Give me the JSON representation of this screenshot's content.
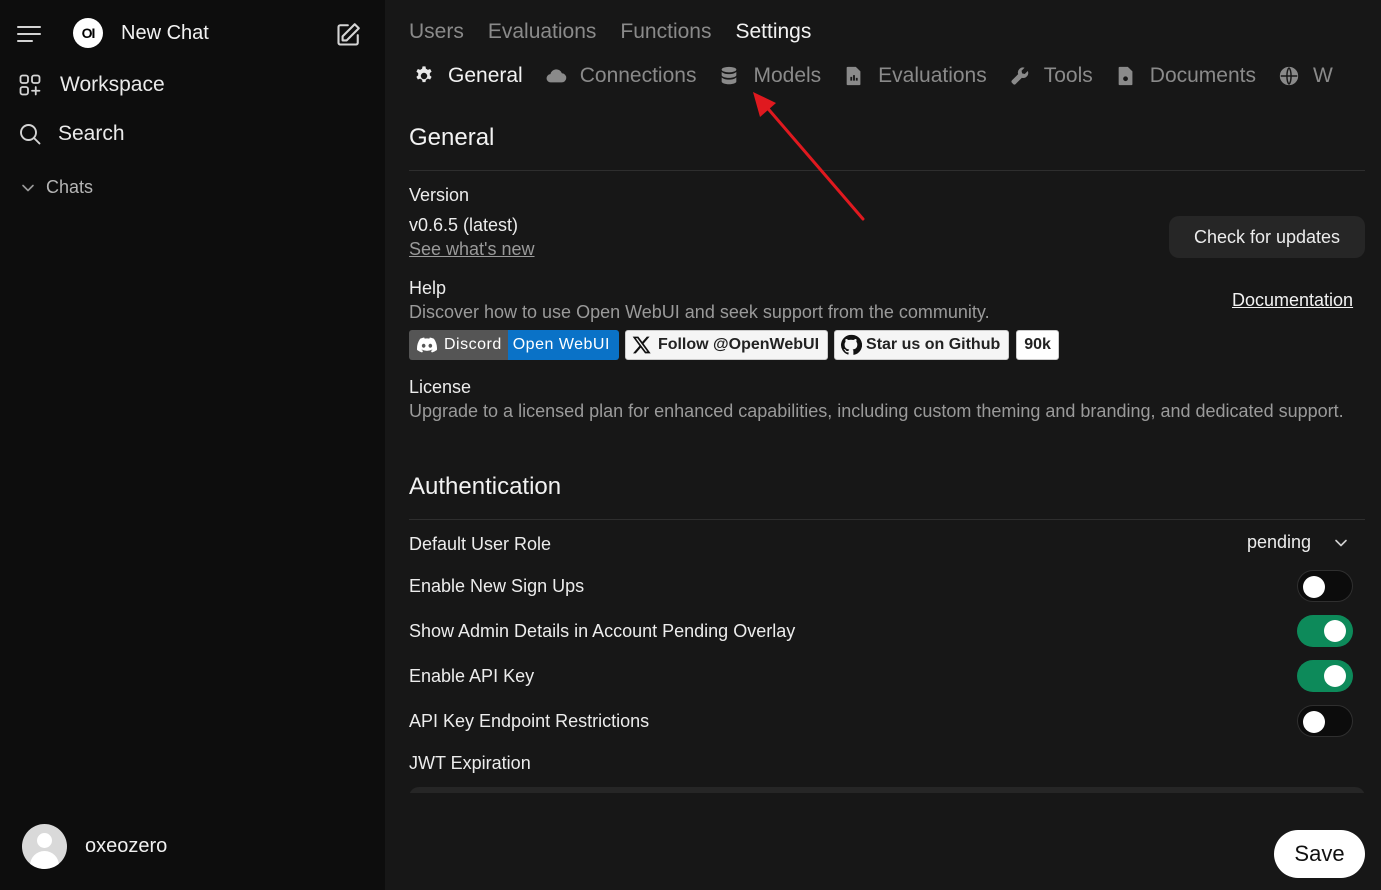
{
  "sidebar": {
    "new_chat_label": "New Chat",
    "logo_text": "OI",
    "items": [
      {
        "label": "Workspace",
        "icon": "workspace-icon"
      },
      {
        "label": "Search",
        "icon": "search-icon"
      }
    ],
    "chats_label": "Chats",
    "username": "oxeozero"
  },
  "top_tabs": [
    {
      "label": "Users",
      "active": false
    },
    {
      "label": "Evaluations",
      "active": false
    },
    {
      "label": "Functions",
      "active": false
    },
    {
      "label": "Settings",
      "active": true
    }
  ],
  "sub_tabs": [
    {
      "label": "General",
      "icon": "gear-icon",
      "active": true
    },
    {
      "label": "Connections",
      "icon": "cloud-icon",
      "active": false
    },
    {
      "label": "Models",
      "icon": "database-icon",
      "active": false
    },
    {
      "label": "Evaluations",
      "icon": "document-chart-icon",
      "active": false
    },
    {
      "label": "Tools",
      "icon": "wrench-icon",
      "active": false
    },
    {
      "label": "Documents",
      "icon": "document-icon",
      "active": false
    },
    {
      "label": "W",
      "icon": "globe-icon",
      "active": false
    }
  ],
  "general": {
    "title": "General",
    "version_label": "Version",
    "version_value": "v0.6.5 (latest)",
    "whats_new_link": "See what's new",
    "check_updates_button": "Check for updates",
    "help_label": "Help",
    "help_text": "Discover how to use Open WebUI and seek support from the community.",
    "documentation_link": "Documentation",
    "badges": {
      "discord_left": "Discord",
      "discord_right": "Open WebUI",
      "x_follow": "Follow @OpenWebUI",
      "github_star": "Star us on Github",
      "github_count": "90k"
    },
    "license_label": "License",
    "license_text": "Upgrade to a licensed plan for enhanced capabilities, including custom theming and branding, and dedicated support."
  },
  "authentication": {
    "title": "Authentication",
    "default_role_label": "Default User Role",
    "default_role_value": "pending",
    "settings": [
      {
        "label": "Enable New Sign Ups",
        "enabled": false
      },
      {
        "label": "Show Admin Details in Account Pending Overlay",
        "enabled": true
      },
      {
        "label": "Enable API Key",
        "enabled": true
      },
      {
        "label": "API Key Endpoint Restrictions",
        "enabled": false
      }
    ],
    "jwt_label": "JWT Expiration"
  },
  "save_button": "Save",
  "colors": {
    "toggle_on": "#0d8a5a",
    "discord_right": "#0a72c7",
    "annotation_arrow": "#e0191f"
  }
}
